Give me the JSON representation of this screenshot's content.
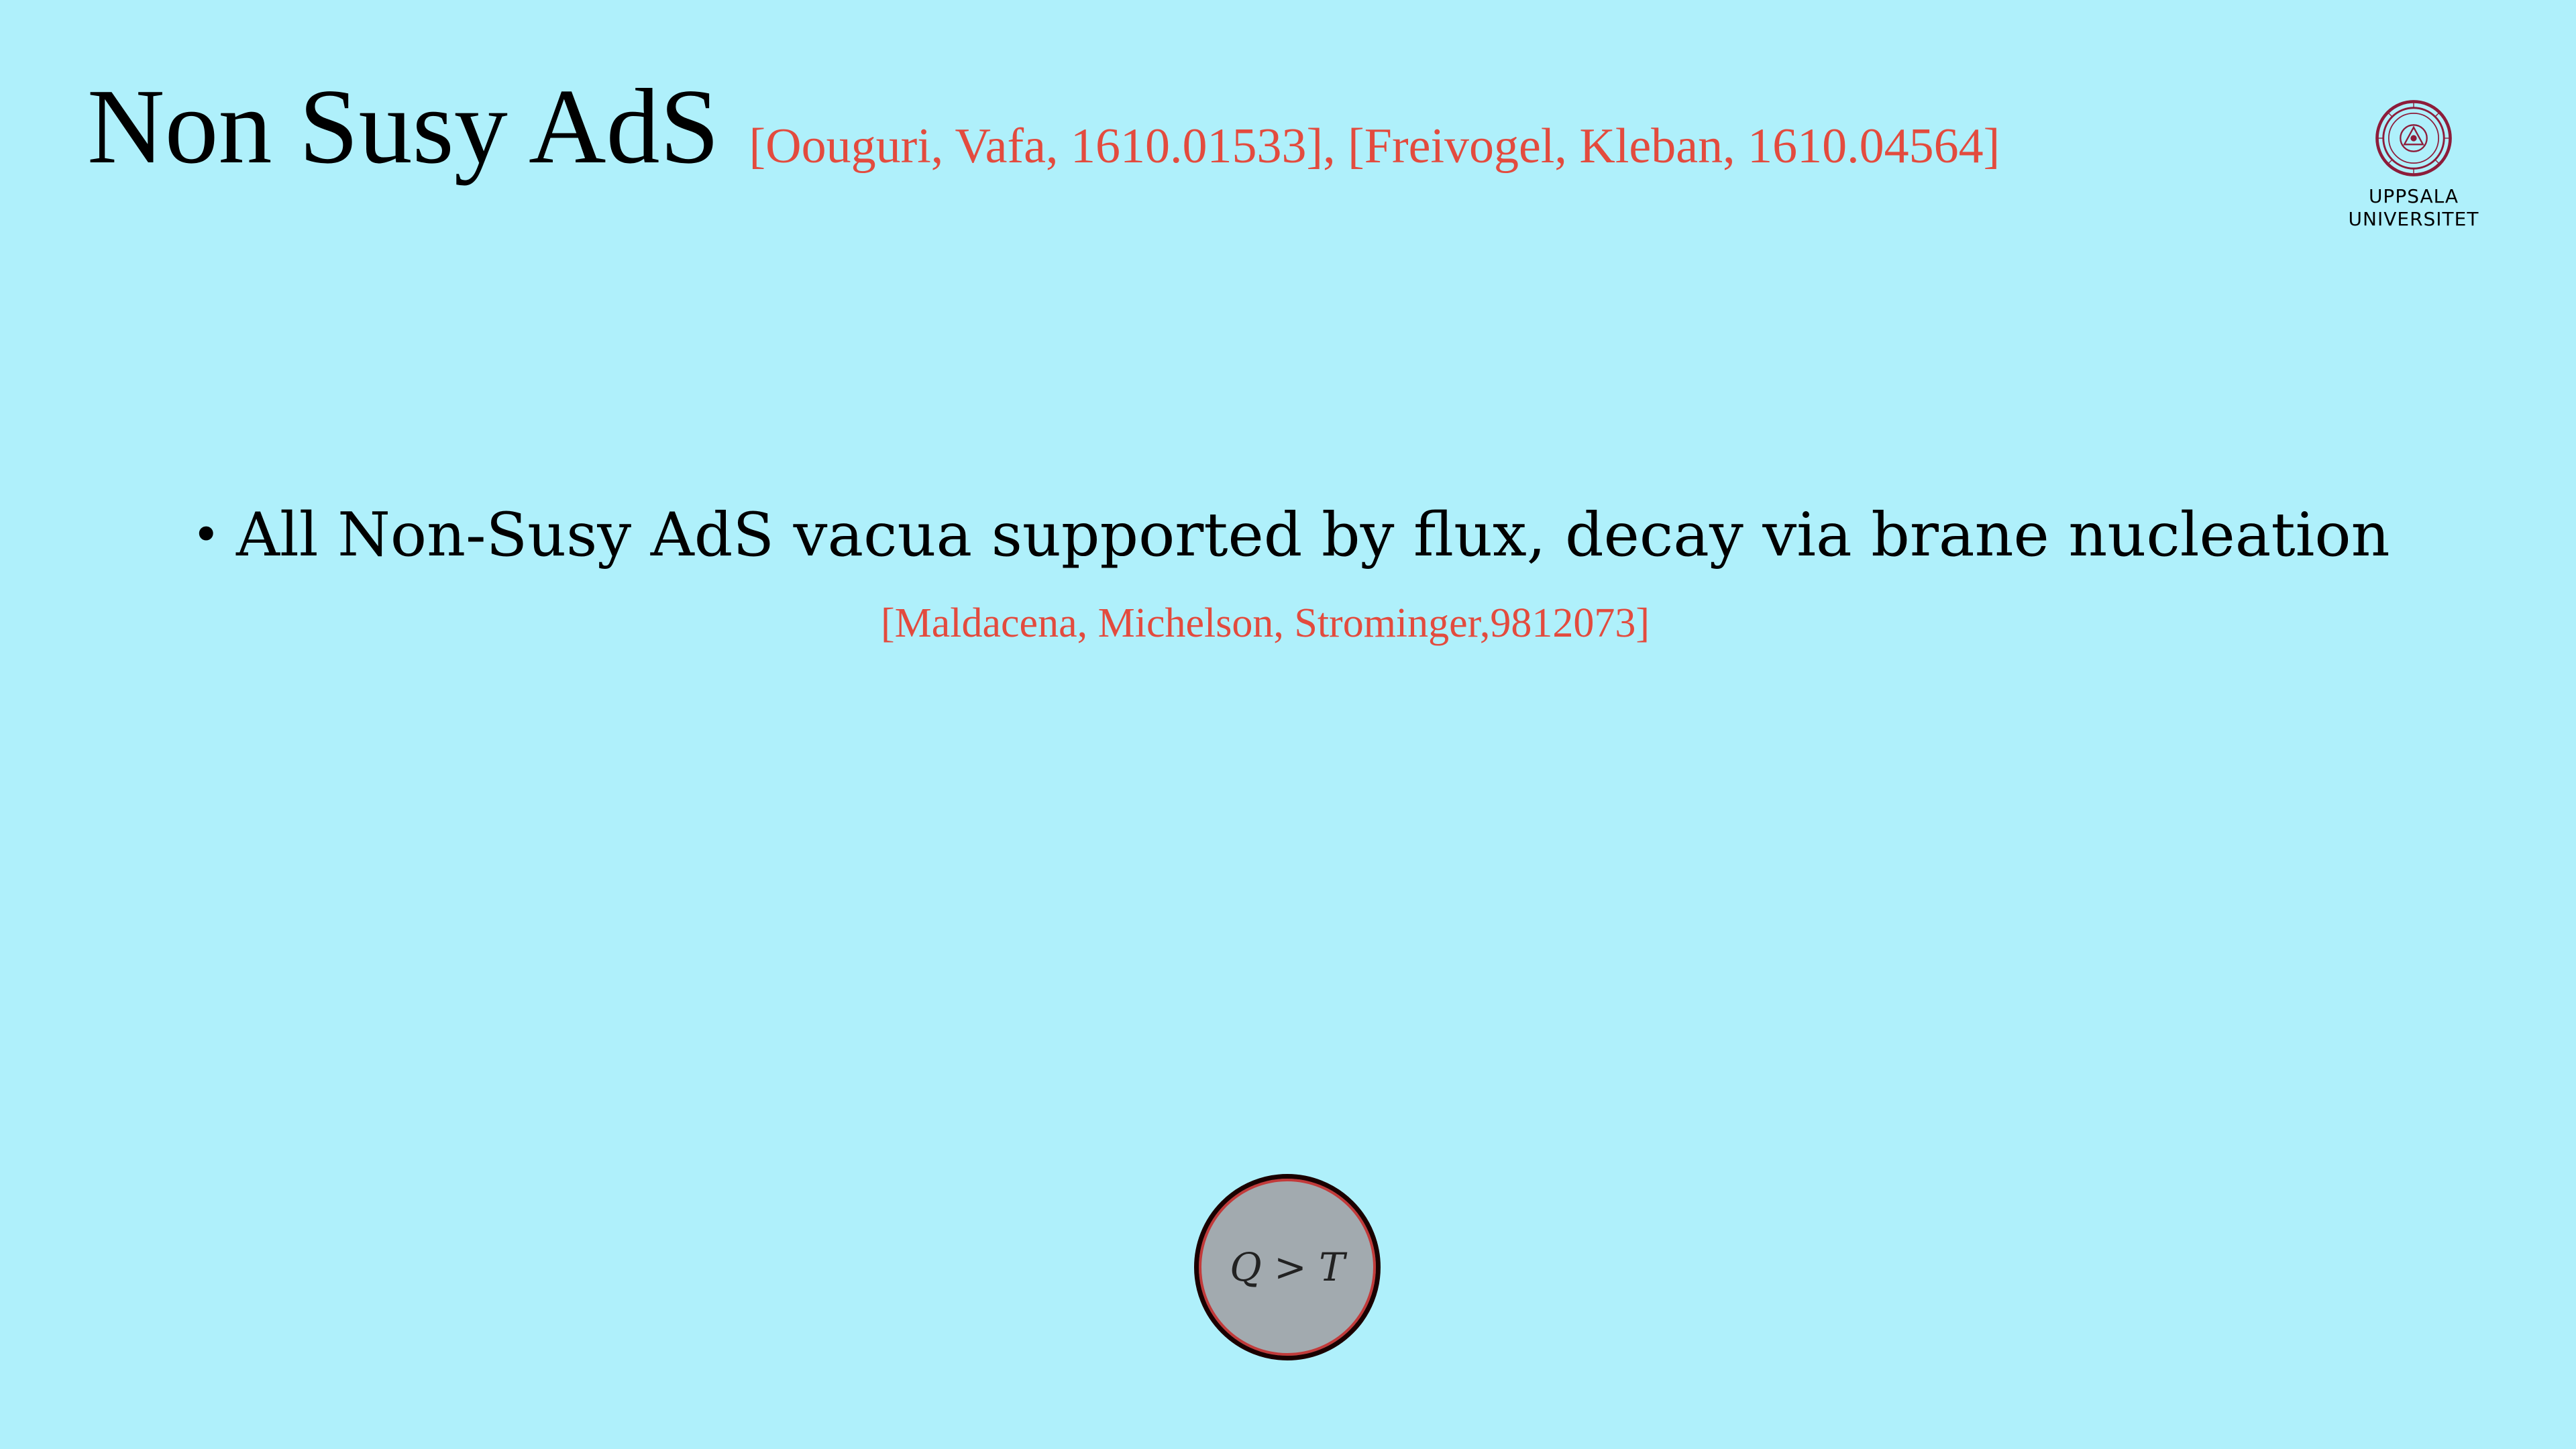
{
  "slide": {
    "title": "Non Susy AdS",
    "title_reference": "[Oouguri, Vafa, 1610.01533], [Freivogel, Kleban, 1610.04564]",
    "logo": {
      "line1": "UPPSALA",
      "line2": "UNIVERSITET"
    },
    "bullets": [
      {
        "text": "All Non-Susy AdS vacua supported by flux, decay via brane nucleation",
        "reference": "[Maldacena, Michelson, Strominger,9812073]"
      }
    ],
    "diagram": {
      "label": "Q > T"
    },
    "colors": {
      "background": "#aff0fb",
      "reference_text": "#e34b3e",
      "bubble_fill": "#a2aaaf",
      "bubble_ring": "#c23a3a"
    }
  }
}
